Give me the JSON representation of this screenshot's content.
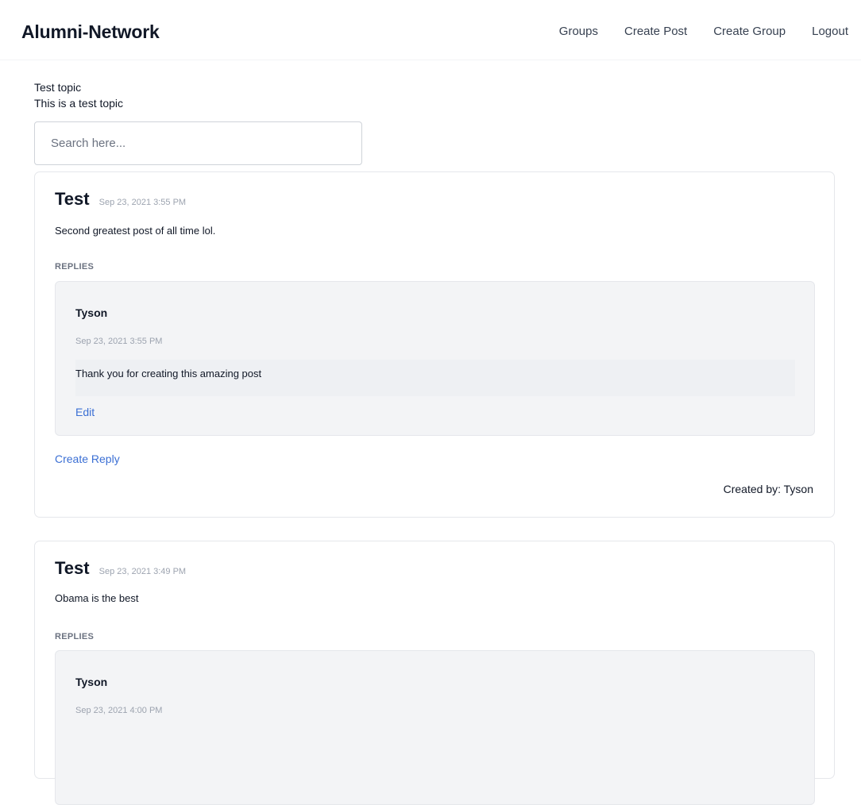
{
  "header": {
    "brand": "Alumni-Network",
    "nav": [
      "Groups",
      "Create Post",
      "Create Group",
      "Logout"
    ]
  },
  "topic": {
    "title": "Test topic",
    "description": "This is a test topic"
  },
  "search": {
    "placeholder": "Search here...",
    "value": ""
  },
  "posts": [
    {
      "title": "Test",
      "date": "Sep 23, 2021 3:55 PM",
      "body": "Second greatest post of all time lol.",
      "replies_label": "REPLIES",
      "replies": [
        {
          "author": "Tyson",
          "date": "Sep 23, 2021 3:55 PM",
          "body": "Thank you for creating this amazing post",
          "edit_label": "Edit"
        }
      ],
      "create_reply_label": "Create Reply",
      "created_by": "Created by: Tyson"
    },
    {
      "title": "Test",
      "date": "Sep 23, 2021 3:49 PM",
      "body": "Obama is the best",
      "replies_label": "REPLIES",
      "replies": [
        {
          "author": "Tyson",
          "date": "Sep 23, 2021 4:00 PM"
        }
      ]
    }
  ]
}
